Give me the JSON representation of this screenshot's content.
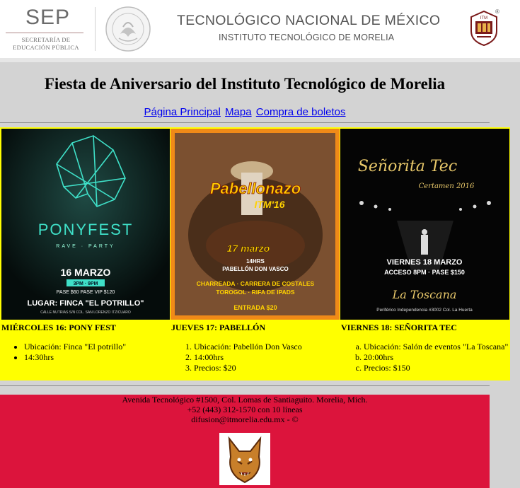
{
  "header": {
    "sep_word": "SEP",
    "sep_sub1": "SECRETARÍA DE",
    "sep_sub2": "EDUCACIÓN PÚBLICA",
    "tec_title": "TECNOLÓGICO NACIONAL DE MÉXICO",
    "tec_sub": "INSTITUTO TECNOLÓGICO DE MORELIA",
    "reg_mark": "®",
    "logo_icons": [
      "sep-logo-icon",
      "mexico-seal-icon",
      "itm-logo-icon"
    ]
  },
  "page_title": "Fiesta de Aniversario del Instituto Tecnológico de Morelia",
  "nav": {
    "home": "Página Principal",
    "map": "Mapa",
    "tickets": "Compra de boletos"
  },
  "posters": {
    "pony": {
      "brand": "PONYFEST",
      "tag": "RAVE · PARTY",
      "date": "16 MARZO",
      "time": "3PM · 9PM",
      "price": "PASE $60  PASE VIP $120",
      "venue": "LUGAR: FINCA \"EL POTRILLO\"",
      "address": "CALLE NUTRIAS S/N COL. SAN LORENZO ITZICUARO"
    },
    "pabellon": {
      "brand": "Pabellonazo",
      "sub": "ITM'16",
      "date": "17 marzo",
      "time": "14HRS",
      "venue": "PABELLÓN DON VASCO",
      "line1": "CHARREADA · CARRERA DE COSTALES",
      "line2": "TOROGOL · RIFA DE IPADS",
      "entry": "ENTRADA $20"
    },
    "senorita": {
      "brand": "Señorita Tec",
      "sub": "Certamen 2016",
      "date": "VIERNES 18 MARZO",
      "access": "ACCESO 8PM · PASE $150",
      "venue": "La Toscana",
      "address": "Periférico Independencia #3002 Col. La Huerta"
    }
  },
  "events": [
    {
      "title": "MIÉRCOLES 16: PONY FEST",
      "items": [
        "Ubicación: Finca \"El potrillo\"",
        "14:30hrs"
      ]
    },
    {
      "title": "JUEVES 17: PABELLÓN",
      "items": [
        "Ubicación: Pabellón Don Vasco",
        "14:00hrs",
        "Precios: $20"
      ]
    },
    {
      "title": "VIERNES 18: SEÑORITA TEC",
      "items": [
        "Ubicación: Salón de eventos \"La Toscana\"",
        "20:00hrs",
        "Precios: $150"
      ]
    }
  ],
  "footer": {
    "address": "Avenida Tecnológico #1500, Col. Lomas de Santiaguito. Morelia, Mich.",
    "phone": "+52 (443) 312-1570 con 10 líneas",
    "email": "difusion@itmorelia.edu.mx - ©"
  },
  "colors": {
    "events_bg": "#ffff00",
    "footer_bg": "#dc143c",
    "page_bg": "#d3d3d3",
    "link": "#0000ee"
  }
}
